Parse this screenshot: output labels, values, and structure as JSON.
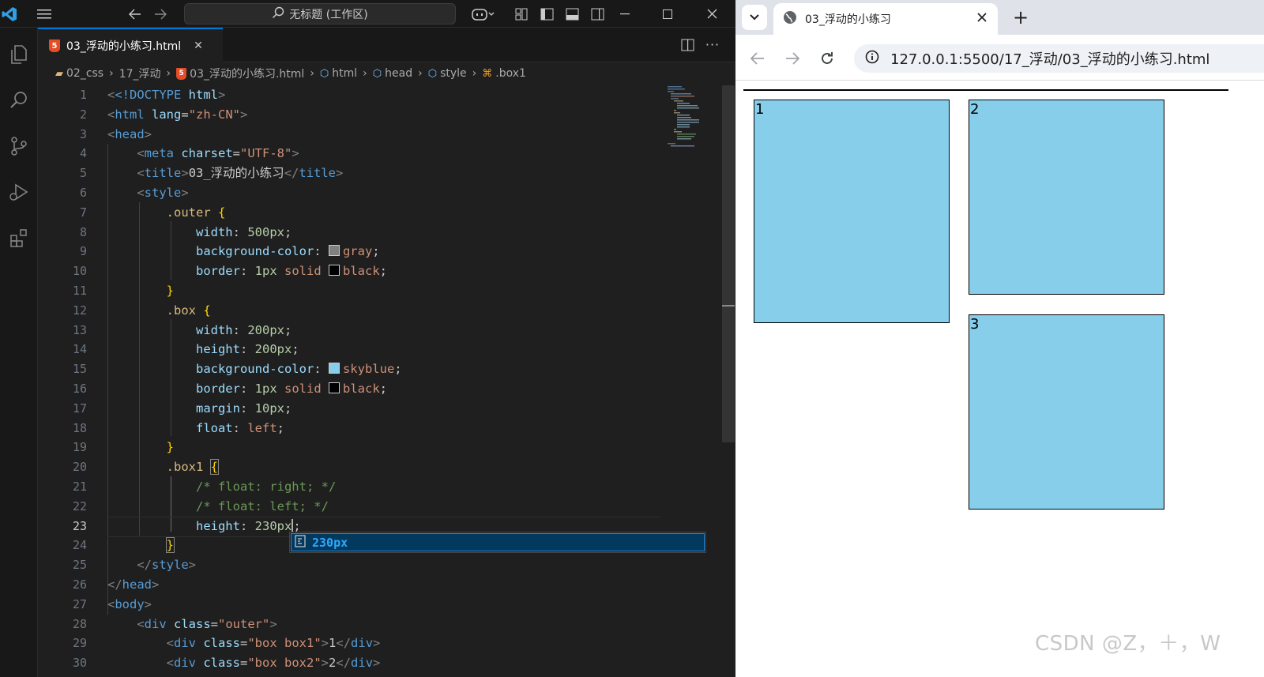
{
  "vscode": {
    "command_center": "无标题 (工作区)",
    "tab": {
      "label": "03_浮动的小练习.html",
      "close": "✕"
    },
    "breadcrumb": [
      "02_css",
      "17_浮动",
      "03_浮动的小练习.html",
      "html",
      "head",
      "style",
      ".box1"
    ],
    "line_numbers": [
      "1",
      "2",
      "3",
      "4",
      "5",
      "6",
      "7",
      "8",
      "9",
      "10",
      "11",
      "12",
      "13",
      "14",
      "15",
      "16",
      "17",
      "18",
      "19",
      "20",
      "21",
      "22",
      "23",
      "24",
      "25",
      "26",
      "27",
      "28",
      "29",
      "30"
    ],
    "current_line": 23,
    "code": {
      "l1": {
        "a": "<!DOCTYPE",
        "b": " html",
        "c": ">"
      },
      "l2": {
        "a": "html",
        "attr": " lang",
        "eq": "=",
        "str": "\"zh-CN\""
      },
      "l3": "head",
      "l4": {
        "tag": "meta",
        "attr": " charset",
        "eq": "=",
        "str": "\"UTF-8\""
      },
      "l5": {
        "tag": "title",
        "text": "03_浮动的小练习",
        "close": "title"
      },
      "l6": "style",
      "l7": {
        "sel": ".outer",
        "brace": " {"
      },
      "l8": {
        "prop": "width",
        "num": "500px"
      },
      "l9": {
        "prop": "background-color",
        "val": "gray"
      },
      "l10": {
        "prop": "border",
        "num": "1px",
        "val1": " solid",
        "val2": "black"
      },
      "l11": "}",
      "l12": {
        "sel": ".box",
        "brace": " {"
      },
      "l13": {
        "prop": "width",
        "num": "200px"
      },
      "l14": {
        "prop": "height",
        "num": "200px"
      },
      "l15": {
        "prop": "background-color",
        "val": "skyblue"
      },
      "l16": {
        "prop": "border",
        "num": "1px",
        "val1": " solid",
        "val2": "black"
      },
      "l17": {
        "prop": "margin",
        "num": "10px"
      },
      "l18": {
        "prop": "float",
        "val": "left"
      },
      "l19": "}",
      "l20": {
        "sel": ".box1",
        "brace": "{"
      },
      "l21": "/* float: right; */",
      "l22": "/* float: left; */",
      "l23": {
        "prop": "height",
        "num": "230px"
      },
      "l24": "}",
      "l25": "style",
      "l26": "head",
      "l27": "body",
      "l28": {
        "tag": "div",
        "attr": " class",
        "eq": "=",
        "str": "\"outer\""
      },
      "l29": {
        "tag": "div",
        "attr": " class",
        "eq": "=",
        "str": "\"box box1\"",
        "text": "1",
        "close": "div"
      },
      "l30": {
        "tag": "div",
        "attr": " class",
        "eq": "=",
        "str": "\"box box2\"",
        "text": "2",
        "close": "div"
      }
    },
    "suggestion": "230px",
    "colors": {
      "gray": "#808080",
      "skyblue": "#87ceeb",
      "black": "#000000",
      "accent": "#0078d4"
    }
  },
  "browser": {
    "tab_title": "03_浮动的小练习",
    "new_tab": "+",
    "url": "127.0.0.1:5500/17_浮动/03_浮动的小练习.html",
    "boxes": [
      "1",
      "2",
      "3"
    ]
  },
  "watermark": "CSDN @Z，＋，W"
}
